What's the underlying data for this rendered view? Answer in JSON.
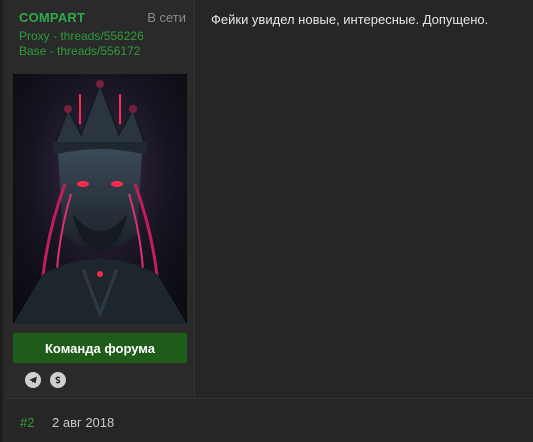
{
  "user": {
    "name": "COMPART",
    "status": "В сети",
    "signature_links": [
      "Proxy - threads/556226",
      "Base - threads/556172"
    ],
    "avatar_icon": "crowned-figure-avatar",
    "group_label": "Команда форума",
    "contacts": [
      "telegram-icon",
      "skype-icon"
    ]
  },
  "post": {
    "message": "Фейки увидел новые, интересные. Допущено."
  },
  "next_post": {
    "number": "#2",
    "date": "2 авг 2018"
  },
  "colors": {
    "accent_green": "#30a94a",
    "group_badge_bg": "#1f5c1a",
    "background": "#262626"
  }
}
